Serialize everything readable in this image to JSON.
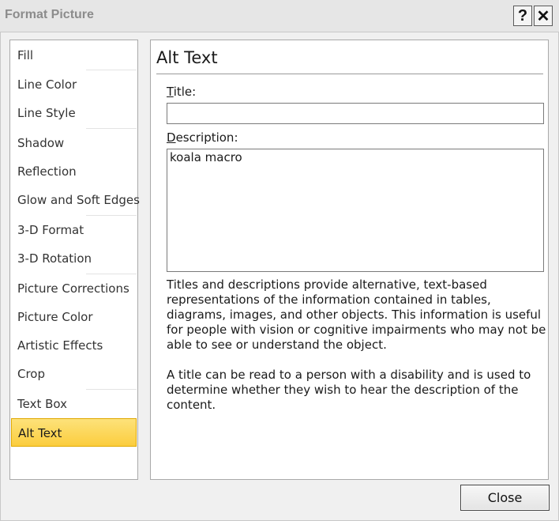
{
  "window": {
    "title": "Format Picture",
    "help_label": "?",
    "close_glyph": "✕"
  },
  "sidebar": {
    "items": [
      {
        "label": "Fill"
      },
      {
        "label": "Line Color"
      },
      {
        "label": "Line Style"
      },
      {
        "label": "Shadow"
      },
      {
        "label": "Reflection"
      },
      {
        "label": "Glow and Soft Edges"
      },
      {
        "label": "3-D Format"
      },
      {
        "label": "3-D Rotation"
      },
      {
        "label": "Picture Corrections"
      },
      {
        "label": "Picture Color"
      },
      {
        "label": "Artistic Effects"
      },
      {
        "label": "Crop"
      },
      {
        "label": "Text Box"
      },
      {
        "label": "Alt Text",
        "selected": true
      }
    ]
  },
  "content": {
    "heading": "Alt Text",
    "title_label_first": "T",
    "title_label_rest": "itle:",
    "title_value": "",
    "description_label_first": "D",
    "description_label_rest": "escription:",
    "description_value": "koala macro",
    "help_paragraph_1": "Titles and descriptions provide alternative, text-based representations of the information contained in tables, diagrams, images, and other objects. This information is useful for people with vision or cognitive impairments who may not be able to see or understand the object.",
    "help_paragraph_2": "A title can be read to a person with a disability and is used to determine whether they wish to hear the description of the content."
  },
  "footer": {
    "close_label": "Close"
  },
  "colors": {
    "selected_item": "#fbcd3e",
    "dialog_background": "#f0f0f0"
  }
}
